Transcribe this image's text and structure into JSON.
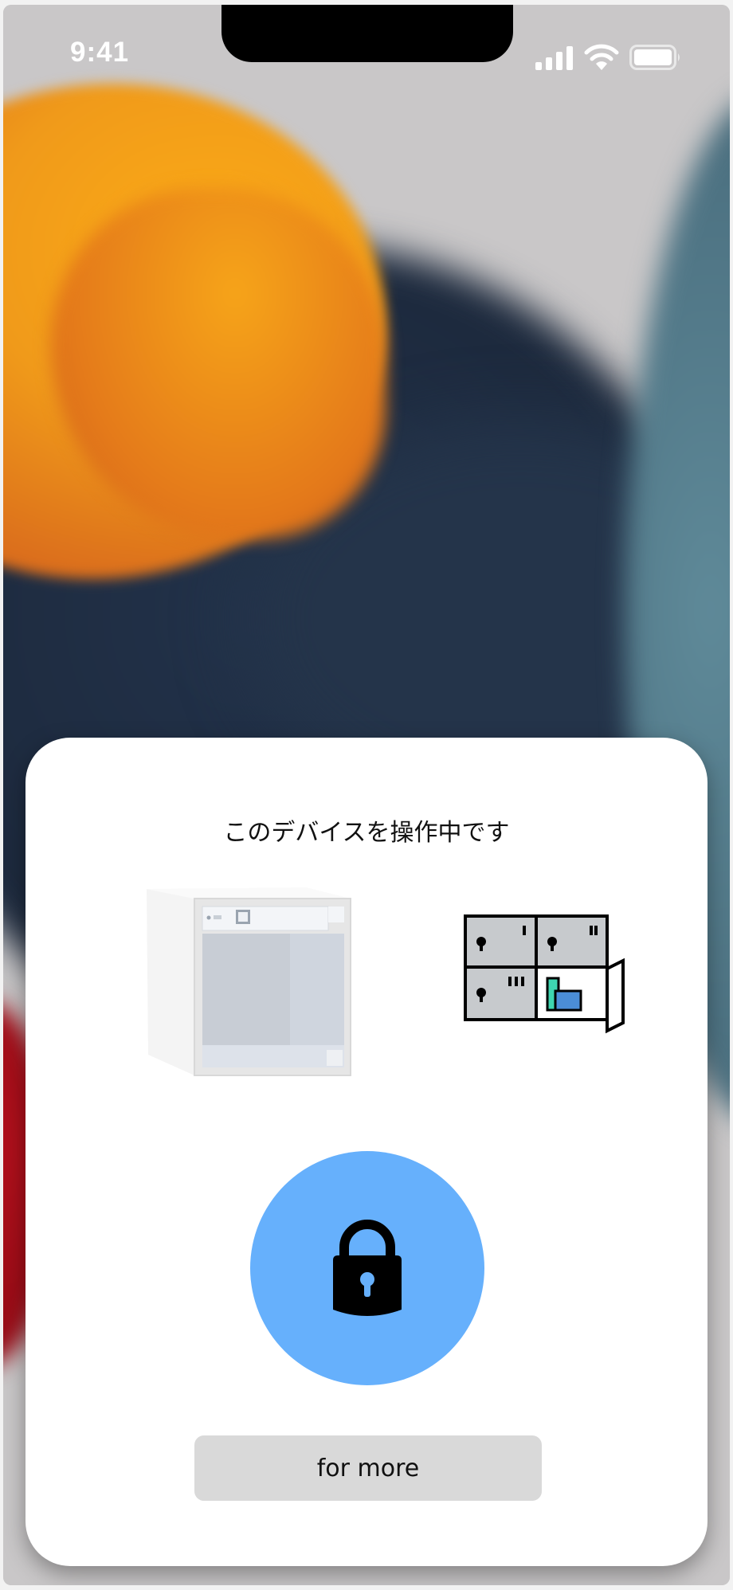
{
  "status_bar": {
    "time": "9:41",
    "icons": [
      "signal-icon",
      "wifi-icon",
      "battery-icon"
    ]
  },
  "card": {
    "title": "このデバイスを操作中です",
    "device_image": "locker-cabinet-photo",
    "device_icon": "locker-icon",
    "lock_button_icon": "lock-icon",
    "lock_button_color": "#66b0fc",
    "more_button_label": "for more"
  }
}
